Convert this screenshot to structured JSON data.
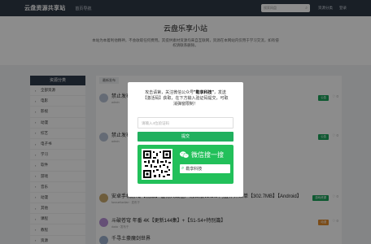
{
  "topbar": {
    "logo": "云盘资源共享站",
    "home": "首页导航",
    "search_placeholder": "搜索网盘",
    "links": [
      "资源分类",
      "登录"
    ]
  },
  "hero": {
    "title": "云盘乐享小站",
    "desc": "本站为本着利他精神，不会收取任何费用。其提供素材资源均来自互联网，资源在本网站内仅用于学习交流，如有侵权请联系删除。"
  },
  "sidebar": {
    "head": "资源分类",
    "items": [
      "全部资源",
      "电影",
      "影视",
      "动漫",
      "综艺",
      "电子书",
      "学习",
      "软件",
      "游戏",
      "音乐",
      "动漫",
      "其他",
      "课程",
      "教程",
      "资源",
      "教程"
    ]
  },
  "filter": {
    "label": "最新发布"
  },
  "rows": [
    {
      "title": "禁止发布",
      "meta": "admin",
      "badge": "公告",
      "badge_color": "#1aa35a",
      "likes": "0"
    },
    {
      "title": "禁止发布",
      "meta": "admin",
      "badge": "公告",
      "badge_color": "#1aa35a",
      "likes": "0"
    },
    {
      "title": "安卓手机游戏【精品】植物大战僵尸融合版v2.1.6 内置作弊菜单【302.7MB】【Android】",
      "meta": "fanxuelianlian · 发布于",
      "badge": "游戏资源",
      "badge_color": "#1aa35a",
      "likes": "0"
    },
    {
      "title": "斗破苍穹 年番 4K【更新144集】+【S1-S4+特别篇】",
      "meta": "dada · 发布于",
      "badge": "动漫",
      "badge_color": "#e08a2c",
      "likes": "0"
    },
    {
      "title": "千寻土豪魔剑世界",
      "meta": "",
      "badge": "",
      "badge_color": "#e08a2c",
      "likes": ""
    }
  ],
  "modal": {
    "line1_pre": "攻击请第，关注微信公众号",
    "line1_brand": "\"勒享科技\"",
    "line1_post": "，发送",
    "line2": "【激活码】获取，在下方输入验证码提交，可取",
    "line3": "消弹窗限制！",
    "input_placeholder": "请输入4位验证码",
    "submit_label": "提交",
    "wechat_title": "微信搜一搜",
    "wechat_account": "勒享科技"
  },
  "colors": {
    "topbar": "#2f3946",
    "accent": "#20b05e",
    "wechat": "#22c05a"
  }
}
